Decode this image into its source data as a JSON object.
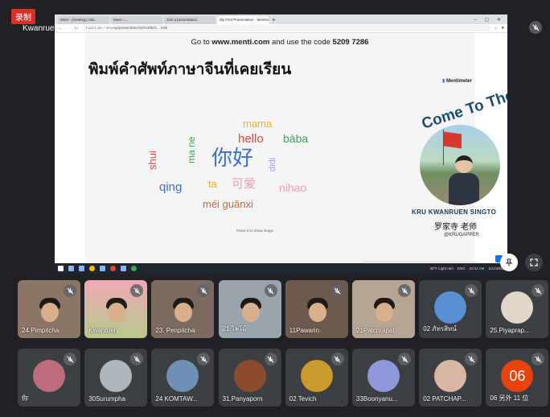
{
  "recording_badge": "录制",
  "presenter_name": "Kwanruen Singto正在展示",
  "browser": {
    "tabs": [
      "Meet - (meeting) nlas.",
      "Meet - ...",
      "Join a presentation",
      "My First Presentation - Mentime"
    ],
    "active_tab_index": 3,
    "url": "mentimeter.com/app/presentation/al7e4dbcb... /edit"
  },
  "slide": {
    "code_prefix": "Go to ",
    "code_site": "www.menti.com",
    "code_middle": " and use the code ",
    "code_number": "5209 7286",
    "title": "พิมพ์คำศัพท์ภาษาจีนที่เคยเรียน",
    "hint": "Press S to show image",
    "word_cloud": [
      "mama",
      "hello",
      "bàba",
      "你好",
      "shui",
      "ma ne",
      "didi",
      "qing",
      "ta",
      "可爱",
      "nihao",
      "méi guānxi"
    ]
  },
  "profile": {
    "brand": "Mentimeter",
    "banner": "Come To The C",
    "name": "KRU KWANRUEN  SINGTO",
    "cn_title": "罗家寺 老师",
    "handle": "@KRUGAPPER"
  },
  "share_bar": {
    "message": "meet.google.com is sharing your screen.",
    "stop_label": "Stop sharing",
    "hide_label": "Hide"
  },
  "taskbar": {
    "weather": "30°F Light rain",
    "time": "10:11 AM",
    "date": "11/1/2021",
    "lang": "ENG"
  },
  "controls": {
    "pin_icon": "pin-icon",
    "fullscreen_icon": "fullscreen-icon"
  },
  "participants_row1": [
    {
      "name": "24.Pimpitcha"
    },
    {
      "name": "Kwanruen"
    },
    {
      "name": "23. Penpitcha"
    },
    {
      "name": "21 ไพโม้"
    },
    {
      "name": "11Pawarin"
    },
    {
      "name": "21Patchrapat"
    },
    {
      "name": "02 ภัทรสิทน์"
    },
    {
      "name": "25.Piyaprap..."
    }
  ],
  "participants_row2": [
    {
      "name": "你"
    },
    {
      "name": "30Surumpha"
    },
    {
      "name": "24 KOMTAW..."
    },
    {
      "name": "31.Panyaporn"
    },
    {
      "name": "02 Tevich"
    },
    {
      "name": "33Boonyanu..."
    },
    {
      "name": "02 PATCHAP..."
    },
    {
      "name": "06  另外 11 位",
      "avatar_text": "06"
    }
  ],
  "colors": {
    "recording": "#d93025",
    "meet_bg": "#202124",
    "tile_bg": "#3c4043",
    "accent": "#1a73e8"
  }
}
